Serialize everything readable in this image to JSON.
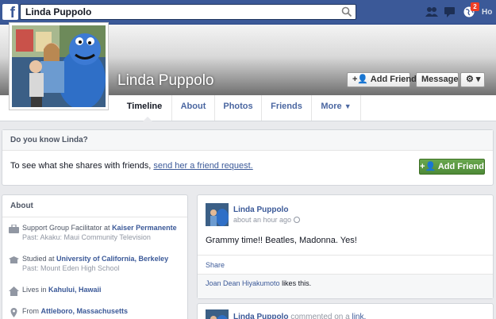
{
  "search": {
    "value": "Linda Puppolo"
  },
  "topbar": {
    "notifications_count": "2",
    "home_label": "Ho"
  },
  "profile": {
    "name": "Linda Puppolo"
  },
  "buttons": {
    "add_friend": "Add Friend",
    "message": "Message"
  },
  "tabs": [
    {
      "label": "Timeline"
    },
    {
      "label": "About"
    },
    {
      "label": "Photos"
    },
    {
      "label": "Friends"
    },
    {
      "label": "More"
    }
  ],
  "know_box": {
    "title": "Do you know Linda?",
    "text": "To see what she shares with friends,",
    "link": "send her a friend request.",
    "button": "Add Friend"
  },
  "about": {
    "title": "About",
    "items": [
      {
        "prefix": "Support Group Facilitator at ",
        "link": "Kaiser Permanente",
        "sub": "Past: Akaku: Maui Community Television"
      },
      {
        "prefix": "Studied at ",
        "link": "University of California, Berkeley",
        "sub": "Past: Mount Eden High School"
      },
      {
        "prefix": "Lives in ",
        "link": "Kahului, Hawaii",
        "sub": ""
      },
      {
        "prefix": "From ",
        "link": "Attleboro, Massachusetts",
        "sub": ""
      }
    ]
  },
  "post": {
    "author": "Linda Puppolo",
    "time": "about an hour ago",
    "body": "Grammy time!! Beatles, Madonna. Yes!",
    "share": "Share",
    "likes_name": "Joan Dean Hiyakumoto",
    "likes_suffix": " likes this."
  },
  "post2": {
    "author": "Linda Puppolo",
    "middle": " commented on a ",
    "link": "link."
  },
  "colors": {
    "brand": "#3b5998",
    "green": "#5b9a42",
    "badge": "#f03d25"
  },
  "icons": {
    "search": "search-icon",
    "friends": "friend-requests-icon",
    "messages": "messages-icon",
    "notifications": "globe-notifications-icon",
    "settings": "gear-icon"
  }
}
